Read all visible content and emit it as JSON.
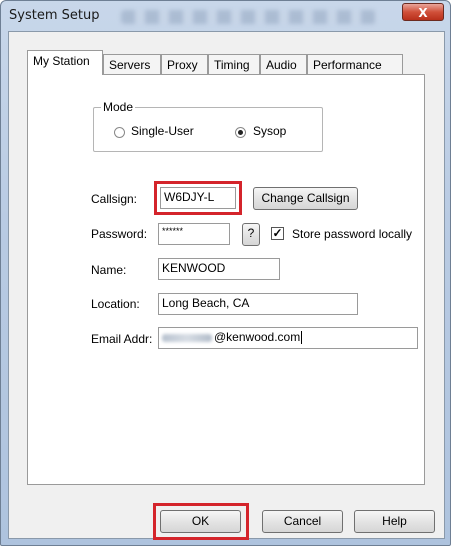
{
  "window": {
    "title": "System Setup",
    "close_label": "X"
  },
  "tabs": [
    {
      "label": "My Station",
      "active": true
    },
    {
      "label": "Servers",
      "active": false
    },
    {
      "label": "Proxy",
      "active": false
    },
    {
      "label": "Timing",
      "active": false
    },
    {
      "label": "Audio",
      "active": false
    },
    {
      "label": "Performance",
      "active": false
    }
  ],
  "mode": {
    "label": "Mode",
    "options": [
      {
        "label": "Single-User",
        "selected": false
      },
      {
        "label": "Sysop",
        "selected": true
      }
    ]
  },
  "form": {
    "callsign_label": "Callsign:",
    "callsign_value": "W6DJY-L",
    "change_callsign_label": "Change Callsign",
    "password_label": "Password:",
    "password_value": "******",
    "help_label": "?",
    "store_password_label": "Store password locally",
    "store_password_checked": true,
    "name_label": "Name:",
    "name_value": "KENWOOD",
    "location_label": "Location:",
    "location_value": "Long Beach, CA",
    "email_label": "Email Addr:",
    "email_value": "@kenwood.com"
  },
  "buttons": {
    "ok": "OK",
    "cancel": "Cancel",
    "help": "Help"
  },
  "colors": {
    "highlight": "#d4242b",
    "title_bar": "#b9cbe3",
    "close": "#c7432d"
  }
}
